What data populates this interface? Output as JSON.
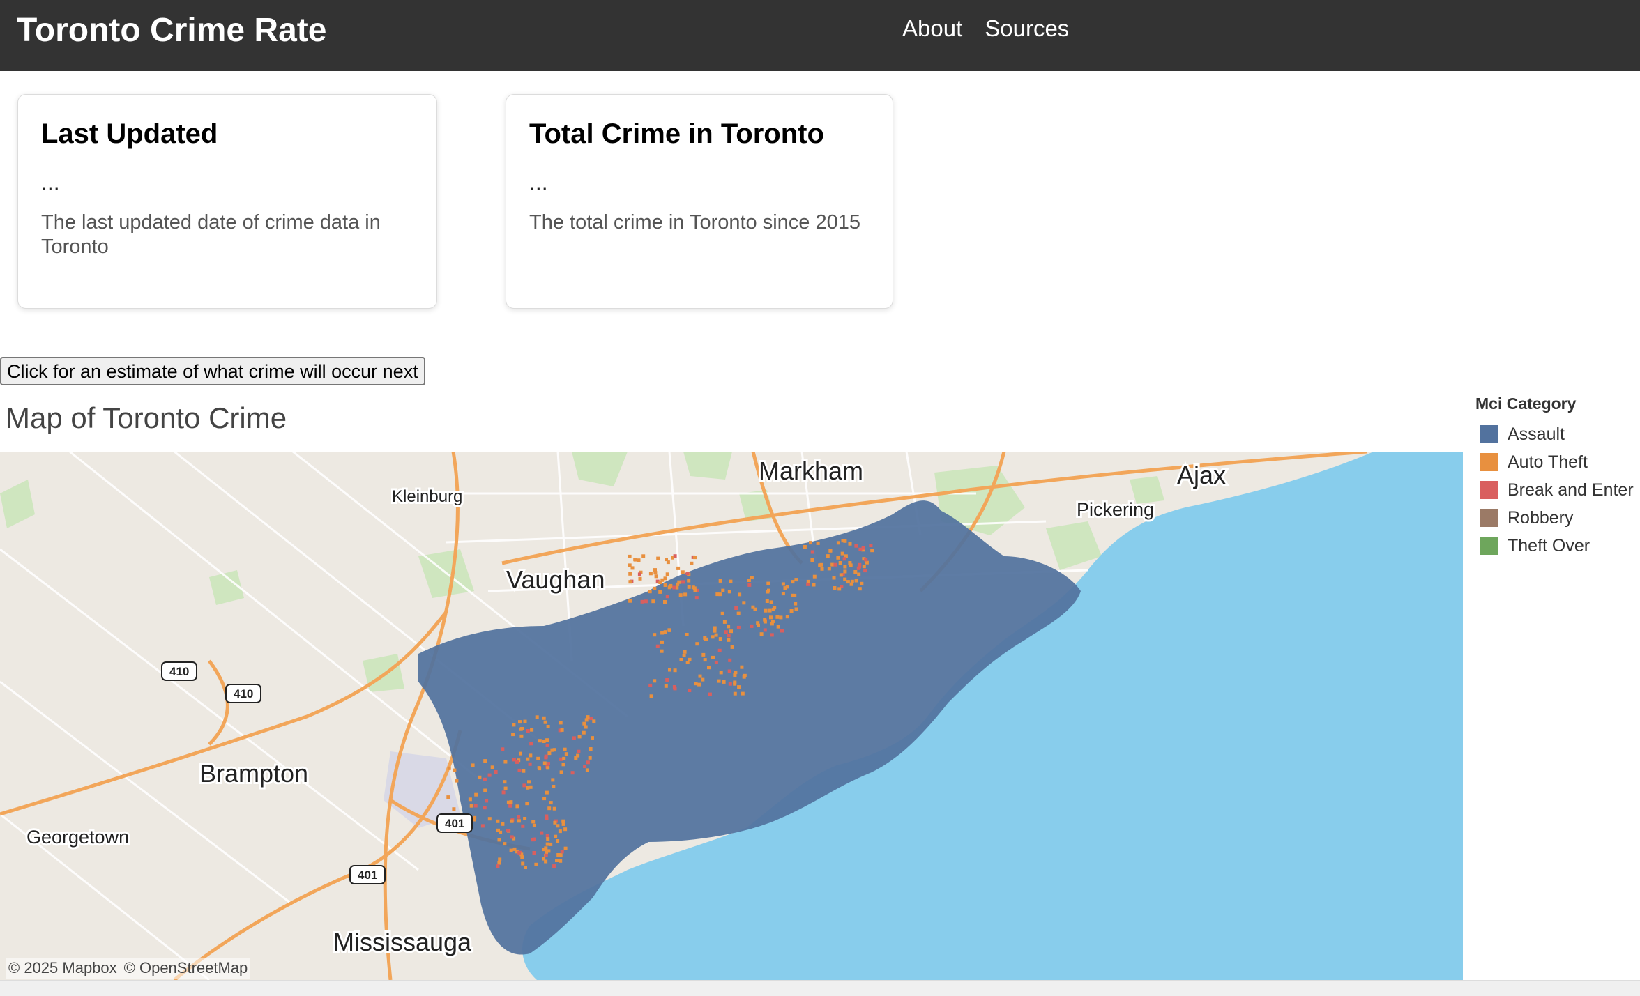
{
  "navbar": {
    "brand": "Toronto Crime Rate",
    "links": [
      {
        "label": "About"
      },
      {
        "label": "Sources"
      }
    ]
  },
  "cards": {
    "last_updated": {
      "title": "Last Updated",
      "value": "...",
      "description": "The last updated date of crime data in Toronto"
    },
    "total_crime": {
      "title": "Total Crime in Toronto",
      "value": "...",
      "description": "The total crime in Toronto since 2015"
    }
  },
  "predict_button": {
    "label": "Click for an estimate of what crime will occur next"
  },
  "map": {
    "title": "Map of Toronto Crime",
    "place_labels": [
      "Markham",
      "Ajax",
      "Kleinburg",
      "Pickering",
      "Vaughan",
      "Brampton",
      "Georgetown",
      "Mississauga"
    ],
    "highway_shields": [
      "410",
      "410",
      "401",
      "401"
    ],
    "attribution": [
      "© 2025 Mapbox",
      "© OpenStreetMap"
    ],
    "colors": {
      "land": "#ede9e2",
      "water": "#88cdec",
      "park": "#cfe6bf",
      "road": "#f2a65a"
    }
  },
  "legend": {
    "title": "Mci Category",
    "items": [
      {
        "label": "Assault",
        "color": "#52729e"
      },
      {
        "label": "Auto Theft",
        "color": "#e8903f"
      },
      {
        "label": "Break and Enter",
        "color": "#d95f5f"
      },
      {
        "label": "Robbery",
        "color": "#9b7a66"
      },
      {
        "label": "Theft Over",
        "color": "#6ea65c"
      }
    ]
  }
}
